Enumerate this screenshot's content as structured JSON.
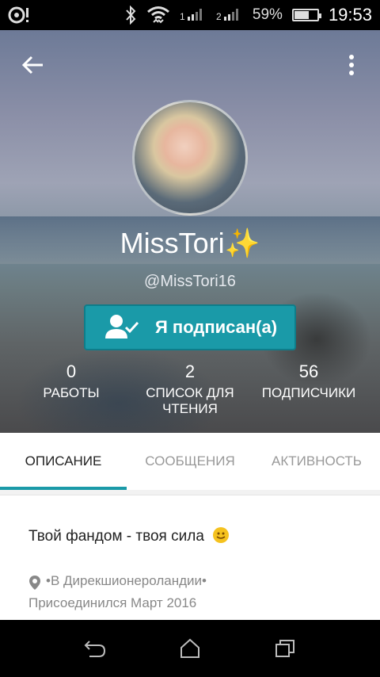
{
  "status_bar": {
    "battery": "59%",
    "battery_level": 0.59,
    "time": "19:53",
    "icons": [
      "sd-card-icon",
      "bluetooth-icon",
      "wifi-icon",
      "signal-1-icon",
      "signal-2-icon",
      "battery-charging-icon"
    ],
    "sim1_label": "1",
    "sim2_label": "2"
  },
  "toolbar": {
    "back_icon": "arrow-left-icon",
    "menu_icon": "more-vert-icon"
  },
  "profile": {
    "display_name": "MissTori✨",
    "handle": "@MissTori16",
    "follow_label": "Я подписан(а)",
    "follow_icon": "person-check-icon"
  },
  "stats": [
    {
      "value": "0",
      "label": "РАБОТЫ"
    },
    {
      "value": "2",
      "label": "СПИСОК ДЛЯ ЧТЕНИЯ"
    },
    {
      "value": "56",
      "label": "ПОДПИСЧИКИ"
    }
  ],
  "tabs": [
    {
      "label": "ОПИСАНИЕ",
      "active": true
    },
    {
      "label": "СООБЩЕНИЯ",
      "active": false
    },
    {
      "label": "АКТИВНОСТЬ",
      "active": false
    }
  ],
  "about": {
    "description": "Твой фандом - твоя сила",
    "location_icon": "map-pin-icon",
    "location": "•В Дирекшионероландии•",
    "joined": "Присоединился Март 2016"
  },
  "nav": {
    "back_icon": "nav-back-icon",
    "home_icon": "nav-home-icon",
    "recents_icon": "nav-recents-icon"
  },
  "colors": {
    "accent": "#1a9aa8",
    "tab_active_text": "#222222",
    "tab_inactive_text": "#999999"
  }
}
